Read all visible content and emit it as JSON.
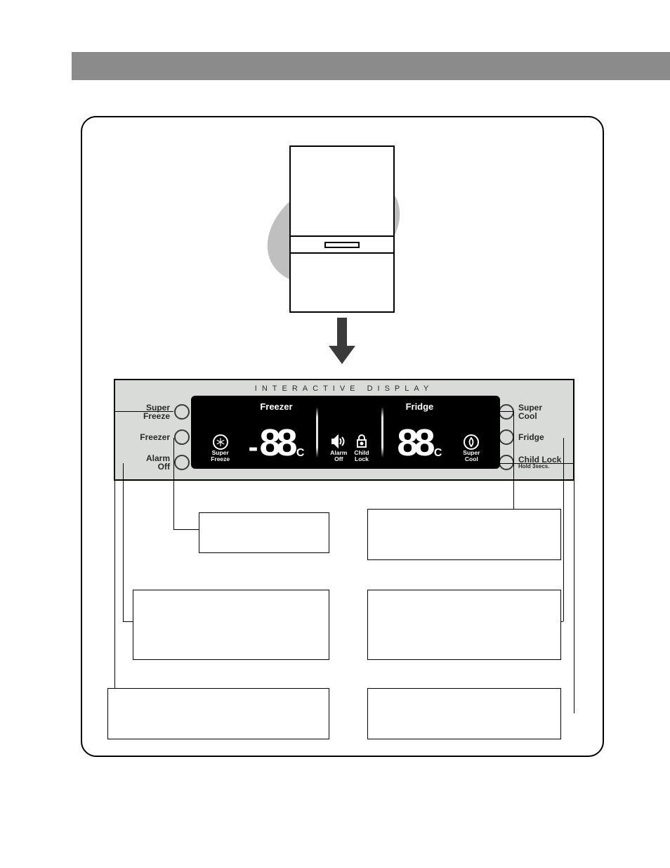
{
  "panel": {
    "title": "INTERACTIVE DISPLAY",
    "left_buttons": [
      {
        "line1": "Super",
        "line2": "Freeze"
      },
      {
        "line1": "Freezer",
        "line2": ""
      },
      {
        "line1": "Alarm",
        "line2": "Off"
      }
    ],
    "right_buttons": [
      {
        "line1": "Super",
        "line2": "Cool",
        "sub": ""
      },
      {
        "line1": "Fridge",
        "line2": "",
        "sub": ""
      },
      {
        "line1": "Child Lock",
        "line2": "",
        "sub": "Hold 3secs."
      }
    ]
  },
  "lcd": {
    "super_freeze_label": "Super\nFreeze",
    "freezer_label": "Freezer",
    "freezer_value": "-88",
    "freezer_unit": "°C",
    "alarm_off_label": "Alarm\nOff",
    "child_lock_label": "Child\nLock",
    "fridge_label": "Fridge",
    "fridge_value": "88",
    "fridge_unit": "°C",
    "super_cool_label": "Super\nCool"
  },
  "icons": {
    "snowflake": "snowflake-icon",
    "speaker": "speaker-icon",
    "lock": "lock-icon",
    "droplet": "droplet-icon"
  }
}
